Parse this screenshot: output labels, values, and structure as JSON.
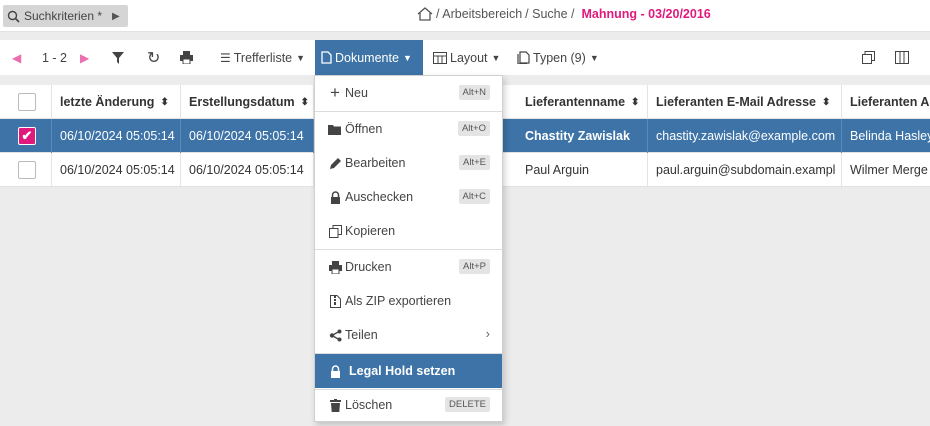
{
  "topbar": {
    "search_criteria": "Suchkriterien *",
    "breadcrumb": [
      "/ Arbeitsbereich",
      "/ Suche /"
    ],
    "breadcrumb_current": "Mahnung - 03/20/2016"
  },
  "toolbar": {
    "pager": "1 - 2",
    "trefferliste": "Trefferliste",
    "dokumente": "Dokumente",
    "layout": "Layout",
    "typen": "Typen (9)"
  },
  "table": {
    "headers": [
      "letzte Änderung",
      "Erstellungsdatum",
      "Lieferantenname",
      "Lieferanten E-Mail Adresse",
      "Lieferanten Ar"
    ],
    "rows": [
      {
        "selected": true,
        "letzte": "06/10/2024 05:05:14",
        "erstellt": "06/10/2024 05:05:14",
        "name": "Chastity Zawislak",
        "email": "chastity.zawislak@example.com",
        "ar": "Belinda Hasley"
      },
      {
        "selected": false,
        "letzte": "06/10/2024 05:05:14",
        "erstellt": "06/10/2024 05:05:14",
        "name": "Paul Arguin",
        "email": "paul.arguin@subdomain.exampl",
        "ar": "Wilmer Merge"
      }
    ]
  },
  "menu": {
    "items": [
      {
        "label": "Neu",
        "shortcut": "Alt+N",
        "icon": "plus-icon"
      },
      {
        "label": "Öffnen",
        "shortcut": "Alt+O",
        "icon": "folder-icon"
      },
      {
        "label": "Bearbeiten",
        "shortcut": "Alt+E",
        "icon": "pencil-icon"
      },
      {
        "label": "Auschecken",
        "shortcut": "Alt+C",
        "icon": "lock-icon"
      },
      {
        "label": "Kopieren",
        "shortcut": "",
        "icon": "copy-icon"
      },
      {
        "label": "Drucken",
        "shortcut": "Alt+P",
        "icon": "printer-icon"
      },
      {
        "label": "Als ZIP exportieren",
        "shortcut": "",
        "icon": "zip-icon"
      },
      {
        "label": "Teilen",
        "shortcut": "",
        "icon": "share-icon"
      },
      {
        "label": "Legal Hold setzen",
        "shortcut": "",
        "icon": "lock-icon"
      },
      {
        "label": "Löschen",
        "shortcut": "DELETE",
        "icon": "trash-icon"
      }
    ]
  },
  "colors": {
    "accent": "#3d73a6",
    "brand_pink": "#e0197d"
  }
}
